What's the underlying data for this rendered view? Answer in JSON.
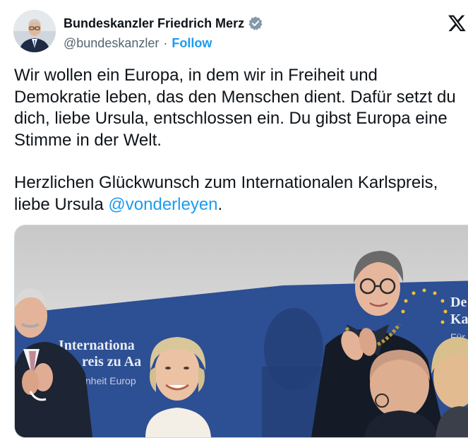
{
  "author": {
    "display_name": "Bundeskanzler Friedrich Merz",
    "handle": "@bundeskanzler",
    "separator": "·",
    "follow_label": "Follow",
    "verified_icon": "verified-badge-icon",
    "avatar_icon": "avatar-photo"
  },
  "platform": {
    "logo_icon": "x-logo-icon"
  },
  "tweet": {
    "paragraph1": "Wir wollen ein Europa, in dem wir in Freiheit und Demokratie leben, das den Menschen dient. Dafür setzt du dich, liebe Ursula, entschlossen ein. Du gibst Europa eine Stimme in der Welt.",
    "paragraph2_text": "Herzlichen Glückwunsch zum Internationalen Karlspreis, liebe Ursula ",
    "mention": "@vonderleyen",
    "paragraph2_end": "."
  },
  "photo": {
    "banner_line1": "Internationa",
    "banner_line2": "reis zu Aa",
    "banner_line3": "nheit Europ",
    "right_banner_line1": "De",
    "right_banner_line2": "Ka",
    "right_banner_line3": "Für"
  },
  "colors": {
    "link": "#1d9bf0",
    "text": "#0f1419",
    "secondary_text": "#536471",
    "banner_blue": "#2d4f93"
  }
}
